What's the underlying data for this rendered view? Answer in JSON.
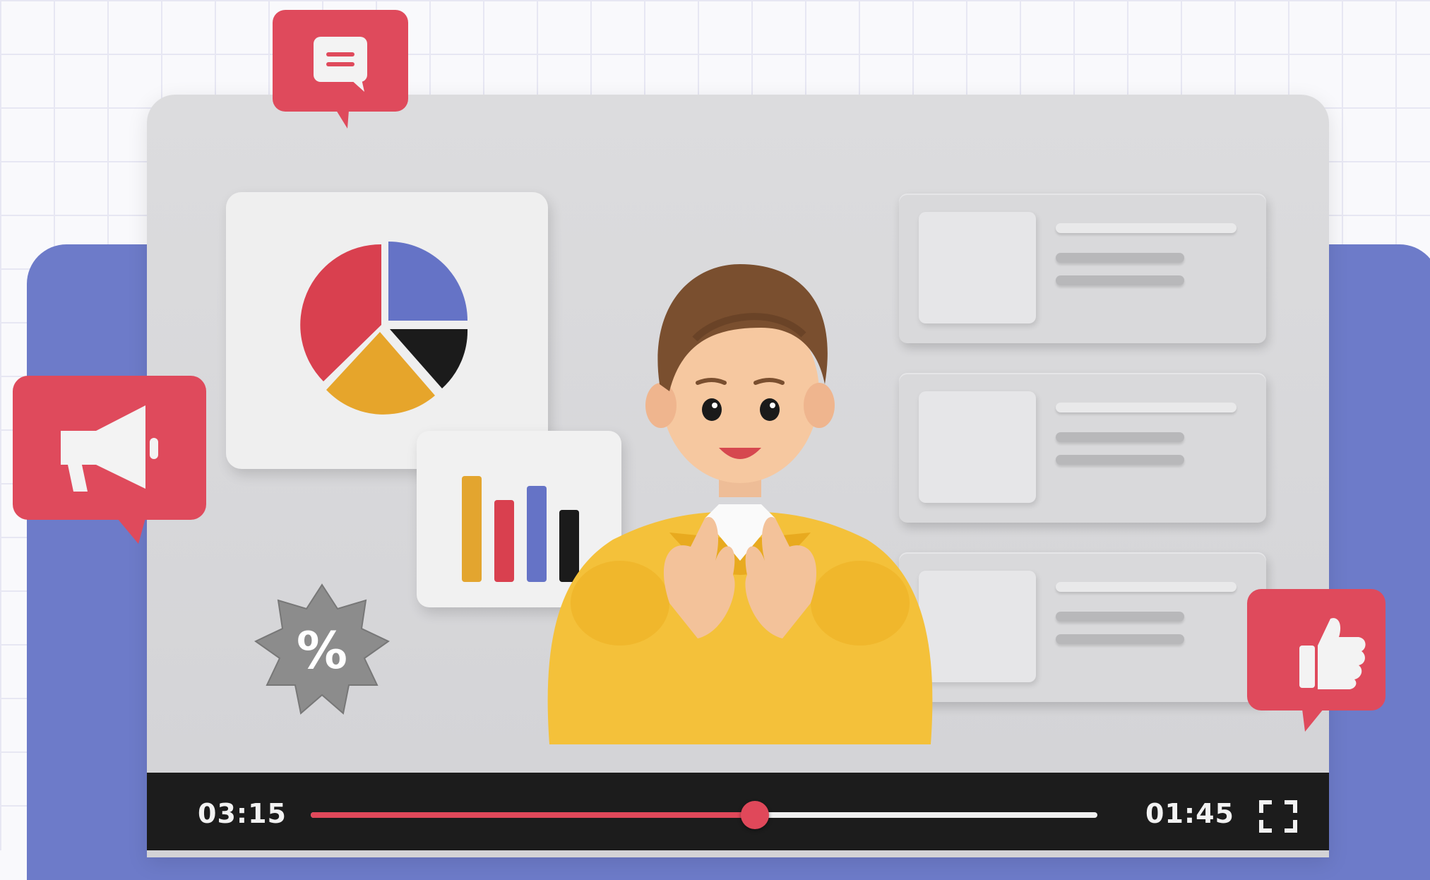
{
  "player": {
    "time_elapsed": "03:15",
    "time_remaining": "01:45",
    "progress": 0.565,
    "fullscreen_icon": "fullscreen-icon",
    "colors": {
      "progress": "#e0485a",
      "bar_bg": "#1c1c1c"
    }
  },
  "pie_chart": {
    "slices": [
      {
        "color": "#d9404f"
      },
      {
        "color": "#6573c6"
      },
      {
        "color": "#1b1b1b"
      },
      {
        "color": "#e6a52b"
      }
    ]
  },
  "bar_chart": {
    "bars": [
      {
        "color": "#e3a52f"
      },
      {
        "color": "#d9404f"
      },
      {
        "color": "#6573c6"
      },
      {
        "color": "#1b1b1b"
      }
    ]
  },
  "badge": {
    "symbol": "%"
  },
  "bubbles": {
    "comment_icon": "chat-icon",
    "announce_icon": "megaphone-icon",
    "like_icon": "thumbs-up-icon",
    "color": "#df4a5c"
  },
  "list_cards": 3
}
